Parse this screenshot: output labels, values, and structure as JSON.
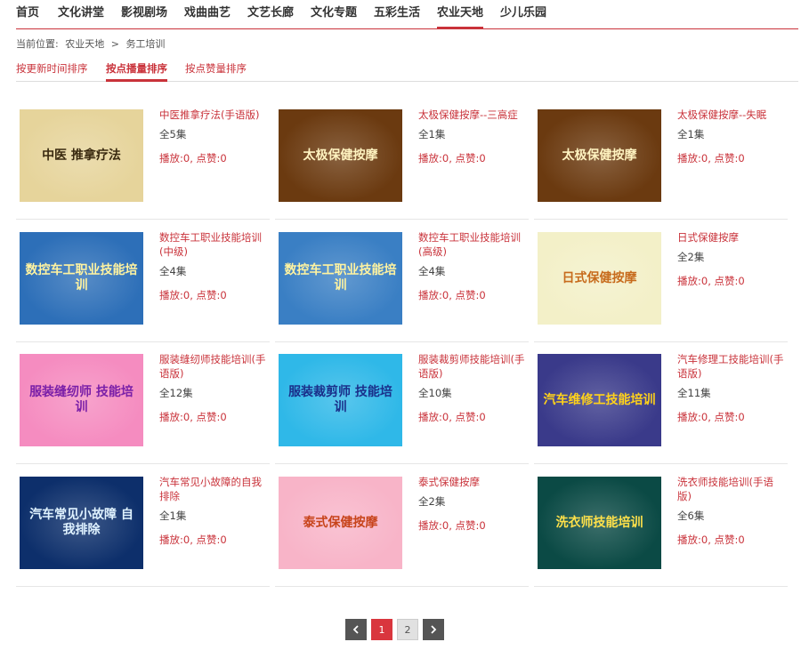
{
  "nav": {
    "items": [
      "首页",
      "文化讲堂",
      "影视剧场",
      "戏曲曲艺",
      "文艺长廊",
      "文化专题",
      "五彩生活",
      "农业天地",
      "少儿乐园"
    ],
    "active": "农业天地"
  },
  "breadcrumb": {
    "label": "当前位置:",
    "path": [
      "农业天地",
      ">",
      "务工培训"
    ]
  },
  "sort": {
    "tabs": [
      "按更新时间排序",
      "按点播量排序",
      "按点赞量排序"
    ],
    "active": "按点播量排序"
  },
  "videos": [
    {
      "title": "中医推拿疗法(手语版)",
      "episodes": "全5集",
      "stats": "播放:0, 点赞:0",
      "thumb_text": "中医 推拿疗法",
      "thumb_bg": "#e6d49b",
      "thumb_fg": "#3a2a10"
    },
    {
      "title": "太极保健按摩--三高症",
      "episodes": "全1集",
      "stats": "播放:0, 点赞:0",
      "thumb_text": "太极保健按摩",
      "thumb_bg": "#6b3a10",
      "thumb_fg": "#fff3c0"
    },
    {
      "title": "太极保健按摩--失眠",
      "episodes": "全1集",
      "stats": "播放:0, 点赞:0",
      "thumb_text": "太极保健按摩",
      "thumb_bg": "#6b3a10",
      "thumb_fg": "#fff3c0"
    },
    {
      "title": "数控车工职业技能培训(中级)",
      "episodes": "全4集",
      "stats": "播放:0, 点赞:0",
      "thumb_text": "数控车工职业技能培训",
      "thumb_bg": "#2d6fb8",
      "thumb_fg": "#fff3a0"
    },
    {
      "title": "数控车工职业技能培训(高级)",
      "episodes": "全4集",
      "stats": "播放:0, 点赞:0",
      "thumb_text": "数控车工职业技能培训",
      "thumb_bg": "#3a7fc4",
      "thumb_fg": "#fff3a0"
    },
    {
      "title": "日式保健按摩",
      "episodes": "全2集",
      "stats": "播放:0, 点赞:0",
      "thumb_text": "日式保健按摩",
      "thumb_bg": "#f3f0c8",
      "thumb_fg": "#c76b1c"
    },
    {
      "title": "服装缝纫师技能培训(手语版)",
      "episodes": "全12集",
      "stats": "播放:0, 点赞:0",
      "thumb_text": "服装缝纫师 技能培训",
      "thumb_bg": "#f58cc0",
      "thumb_fg": "#7a1fa8"
    },
    {
      "title": "服装裁剪师技能培训(手语版)",
      "episodes": "全10集",
      "stats": "播放:0, 点赞:0",
      "thumb_text": "服装裁剪师 技能培训",
      "thumb_bg": "#2fb8e8",
      "thumb_fg": "#1a2f8a"
    },
    {
      "title": "汽车修理工技能培训(手语版)",
      "episodes": "全11集",
      "stats": "播放:0, 点赞:0",
      "thumb_text": "汽车维修工技能培训",
      "thumb_bg": "#3a3a8a",
      "thumb_fg": "#ffd21a"
    },
    {
      "title": "汽车常见小故障的自我排除",
      "episodes": "全1集",
      "stats": "播放:0, 点赞:0",
      "thumb_text": "汽车常见小故障 自我排除",
      "thumb_bg": "#0d2f6b",
      "thumb_fg": "#dff2ff"
    },
    {
      "title": "泰式保健按摩",
      "episodes": "全2集",
      "stats": "播放:0, 点赞:0",
      "thumb_text": "泰式保健按摩",
      "thumb_bg": "#f8b4c8",
      "thumb_fg": "#c7431a"
    },
    {
      "title": "洗衣师技能培训(手语版)",
      "episodes": "全6集",
      "stats": "播放:0, 点赞:0",
      "thumb_text": "洗衣师技能培训",
      "thumb_bg": "#0b4a45",
      "thumb_fg": "#ffe14a"
    }
  ],
  "pagination": {
    "pages": [
      "1",
      "2"
    ],
    "current": "1"
  },
  "colors": {
    "accent": "#c9323a"
  }
}
